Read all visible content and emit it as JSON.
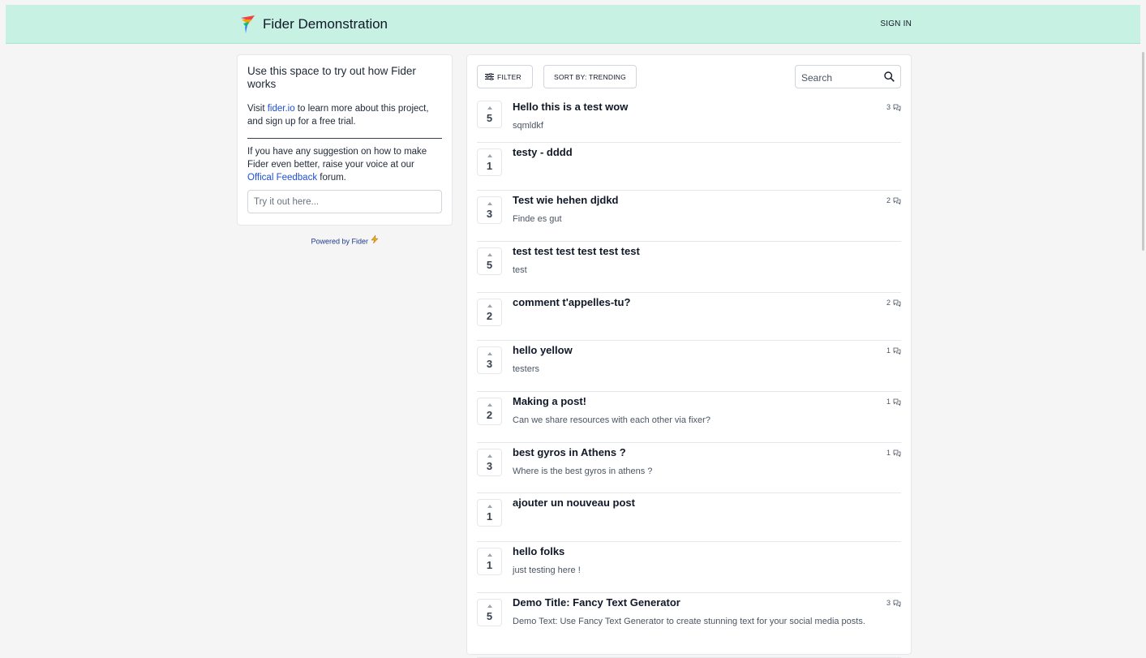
{
  "header": {
    "title": "Fider Demonstration",
    "sign_in": "SIGN IN"
  },
  "sidebar": {
    "heading": "Use this space to try out how Fider works",
    "p1_before": "Visit ",
    "p1_link": "fider.io",
    "p1_after": " to learn more about this project, and sign up for a free trial.",
    "p2_before": "If you have any suggestion on how to make Fider even better, raise your voice at our ",
    "p2_link": "Offical Feedback",
    "p2_after": " forum.",
    "input_placeholder": "Try it out here...",
    "powered_by": "Powered by Fider"
  },
  "toolbar": {
    "filter_label": "FILTER",
    "sort_label": "SORT BY: TRENDING",
    "search_placeholder": "Search"
  },
  "posts": [
    {
      "votes": "5",
      "title": "Hello this is a test wow",
      "description": "sqmldkf",
      "comments": "3"
    },
    {
      "votes": "1",
      "title": "testy - dddd",
      "description": "",
      "comments": ""
    },
    {
      "votes": "3",
      "title": "Test wie hehen djdkd",
      "description": "Finde es gut",
      "comments": "2"
    },
    {
      "votes": "5",
      "title": "test test test test test test",
      "description": "test",
      "comments": ""
    },
    {
      "votes": "2",
      "title": "comment t'appelles-tu?",
      "description": "",
      "comments": "2"
    },
    {
      "votes": "3",
      "title": "hello yellow",
      "description": "testers",
      "comments": "1"
    },
    {
      "votes": "2",
      "title": "Making a post!",
      "description": "Can we share resources with each other via fixer?",
      "comments": "1"
    },
    {
      "votes": "3",
      "title": "best gyros in Athens ?",
      "description": "Where is the best gyros in athens ?",
      "comments": "1"
    },
    {
      "votes": "1",
      "title": "ajouter un nouveau post",
      "description": "",
      "comments": ""
    },
    {
      "votes": "1",
      "title": "hello folks",
      "description": "just testing here !",
      "comments": ""
    },
    {
      "votes": "5",
      "title": "Demo Title: Fancy Text Generator",
      "description": "Demo Text: Use Fancy Text Generator to create stunning text for your social media posts.",
      "comments": "3"
    }
  ],
  "icons": {
    "logo": "fider-logo-icon",
    "filter": "sliders-icon",
    "search": "search-icon",
    "upvote": "caret-up-icon",
    "comment": "speech-bubbles-icon",
    "powered": "lightning-icon"
  }
}
